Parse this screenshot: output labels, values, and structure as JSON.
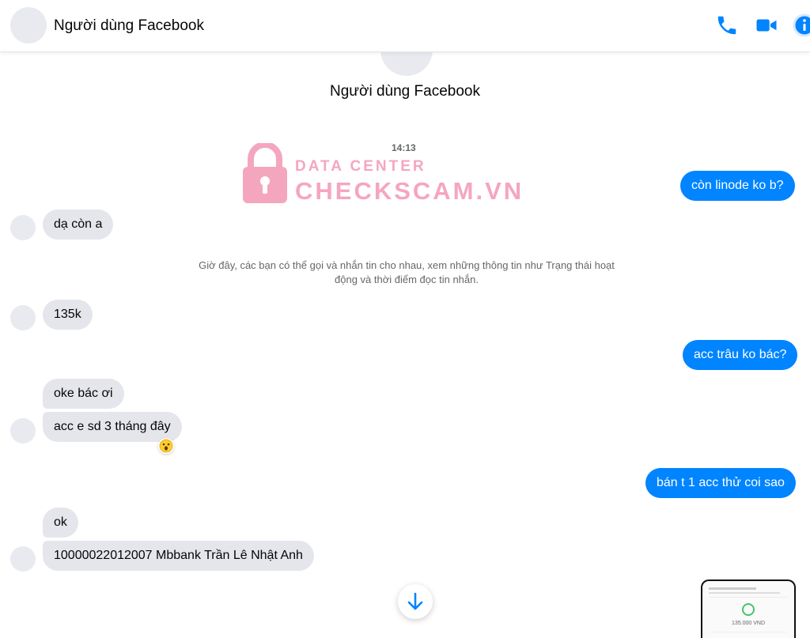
{
  "header": {
    "contact_name": "Người dùng Facebook"
  },
  "profile": {
    "name": "Người dùng Facebook"
  },
  "conversation": {
    "timestamp": "14:13",
    "system_note": "Giờ đây, các bạn có thể gọi và nhắn tin cho nhau, xem những thông tin như Trạng thái hoạt động và thời điểm đọc tin nhắn.",
    "messages": [
      {
        "side": "out",
        "text": "còn linode ko b?"
      },
      {
        "side": "in",
        "text": "dạ còn a"
      },
      {
        "side": "in",
        "text": "135k"
      },
      {
        "side": "out",
        "text": "acc trâu ko bác?"
      },
      {
        "side": "in",
        "text": "oke bác ơi"
      },
      {
        "side": "in",
        "text": "acc e sd 3 tháng đây",
        "reaction": "😮"
      },
      {
        "side": "out",
        "text": "bán t 1 acc thử coi sao"
      },
      {
        "side": "in",
        "text": "ok"
      },
      {
        "side": "in",
        "text": "10000022012007 Mbbank Trần Lê Nhật Anh"
      }
    ]
  },
  "watermark": {
    "line1": "DATA CENTER",
    "line2": "CHECKSCAM.VN"
  },
  "attachment_preview": {
    "amount": "135.000 VND"
  },
  "icons": {
    "phone": "phone-icon",
    "video": "video-call-icon",
    "info": "info-icon",
    "scroll": "arrow-down-icon",
    "lock": "lock-icon"
  },
  "colors": {
    "accent": "#0084ff",
    "incoming_bubble": "#e4e6eb",
    "watermark": "#f5a6bf"
  }
}
